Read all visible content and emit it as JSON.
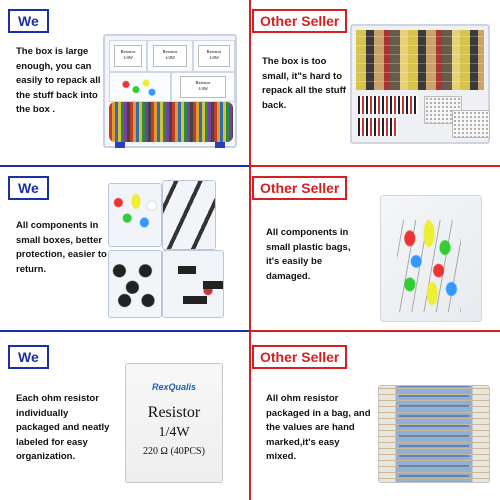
{
  "rows": [
    {
      "left": {
        "tag": "We",
        "description": "The box is large enough, you can easily to repack all the stuff back into the box ."
      },
      "right": {
        "tag": "Other Seller",
        "description": "The box is too small, it\"s hard to repack all the stuff back."
      }
    },
    {
      "left": {
        "tag": "We",
        "description": "All components in small boxes, better protection, easier to return."
      },
      "right": {
        "tag": "Other Seller",
        "description": "All components in small plastic bags, it's easily be damaged."
      }
    },
    {
      "left": {
        "tag": "We",
        "description": "Each ohm resistor individually packaged and neatly labeled for easy organization."
      },
      "right": {
        "tag": "Other Seller",
        "description": "All ohm resistor packaged in a bag, and the values are hand marked,it's easy mixed."
      }
    }
  ],
  "resistor_label": {
    "brand": "RexQualis",
    "title": "Resistor",
    "rating": "1/4W",
    "value": "220 Ω (40PCS)"
  },
  "box_label": {
    "line1": "Resistor",
    "line2": "1/4W"
  },
  "colors": {
    "we_blue": "#1a2fa8",
    "other_red": "#d81e1e"
  }
}
